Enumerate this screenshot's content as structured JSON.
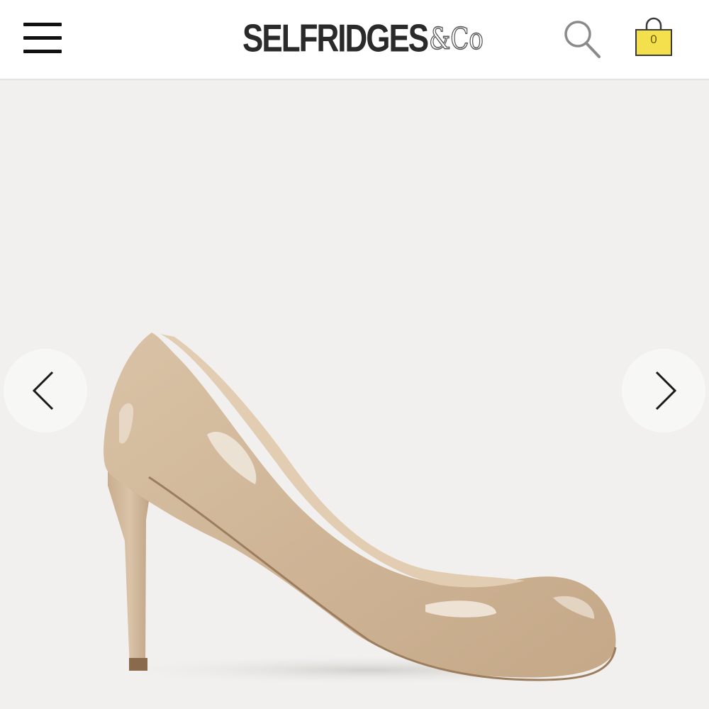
{
  "header": {
    "menu_icon": "hamburger-menu-icon",
    "logo": {
      "main": "SELFRIDGES",
      "suffix": "&Co"
    },
    "search_icon": "search-icon",
    "bag": {
      "icon": "shopping-bag-icon",
      "count": "0",
      "color": "#f4e04d"
    }
  },
  "product": {
    "image": "nude-patent-leather-stiletto-pump-shoe",
    "carousel": {
      "prev_icon": "chevron-left-icon",
      "next_icon": "chevron-right-icon"
    }
  },
  "colors": {
    "header_bg": "#ffffff",
    "page_bg": "#f1f0ee",
    "logo_text": "#2a2a2a",
    "shoe": "#d2b89b"
  }
}
